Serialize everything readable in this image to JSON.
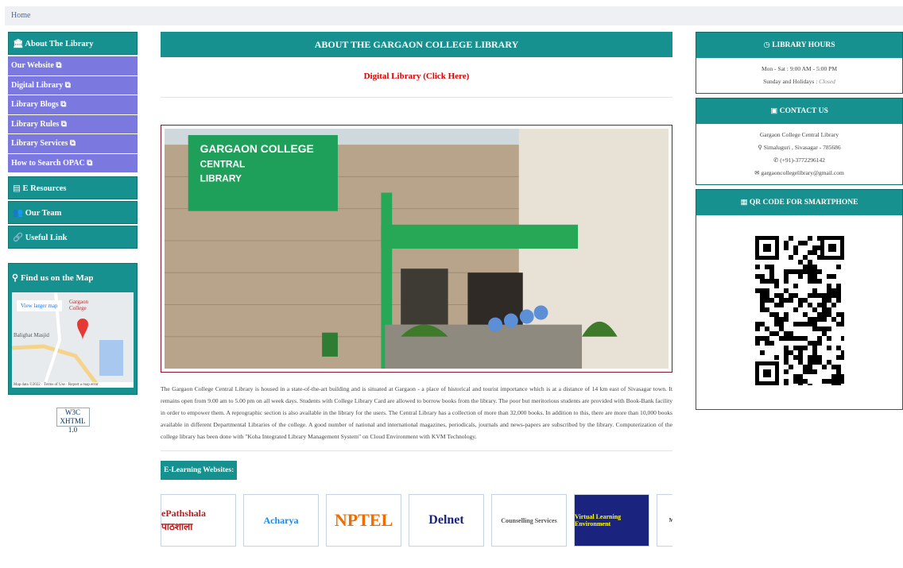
{
  "breadcrumb": {
    "home": "Home"
  },
  "left": {
    "about": "About The Library",
    "about_items": [
      "Our Website",
      "Digital Library",
      "Library Blogs",
      "Library Rules",
      "Library Services",
      "How to Search OPAC"
    ],
    "e_resources": "E Resources",
    "our_team": "Our Team",
    "useful_link": "Useful Link",
    "map_title": "Find us on the Map",
    "map_view_larger": "View larger map",
    "map_place": "Gargaon College",
    "map_nearby": "Balighat Masjid",
    "map_footer": "Map data ©2022 · Terms of Use · Report a map error",
    "w3c_badge": "W3C XHTML 1.0"
  },
  "main": {
    "title": "ABOUT THE GARGAON COLLEGE LIBRARY",
    "digital_link": "Digital Library (Click Here)",
    "photo_sign": "GARGAON COLLEGE CENTRAL LIBRARY",
    "paragraph": "The Gargaon College Central Library is housed in a state-of-the-art building and is situated at Gargaon - a place of historical and tourist importance which is at a distance of 14 km east of Sivasagar town. It remains open from 9.00 am to 5.00 pm on all week days. Students with College Library Card are allowed to borrow books from the library. The poor but meritorious students are provided with Book-Bank facility in order to empower them. A reprographic section is also available in the library for the users. The Central Library has a collection of more than 32,000 books. In addition to this, there are more than 10,000 books available in different Departmental Libraries of the college. A good number of national and international magazines, periodicals, journals and news-papers are subscribed by the library. Computerization of the college library has been done with \"Koha Integrated Library Management System\" on Cloud Environment with KVM Technology.",
    "elearning_title": "E-Learning Websites:",
    "elearning": [
      "ePathshala पाठशाला",
      "Acharya",
      "NPTEL",
      "Delnet",
      "Counselling Services",
      "Virtual Learning Environment",
      "MINISTRY OF HRD"
    ]
  },
  "right": {
    "hours_title": "LIBRARY HOURS",
    "hours_line1": "Mon - Sat : 9:00 AM - 5:00 PM",
    "hours_line2_prefix": "Sunday and Holidays : ",
    "hours_line2_closed": "Closed",
    "contact_title": "CONTACT US",
    "contact_name": "Gargaon College Central Library",
    "contact_addr": "Simaluguri , Sivasagar - 785686",
    "contact_phone": "(+91)-3772296142",
    "contact_email": "gargaoncollegelibrary@gmail.com",
    "qr_title": "QR CODE FOR SMARTPHONE"
  },
  "colors": {
    "teal": "#17918f",
    "purple": "#7b78e0",
    "red_link": "#dd0000",
    "photo_border": "#8a1533"
  }
}
